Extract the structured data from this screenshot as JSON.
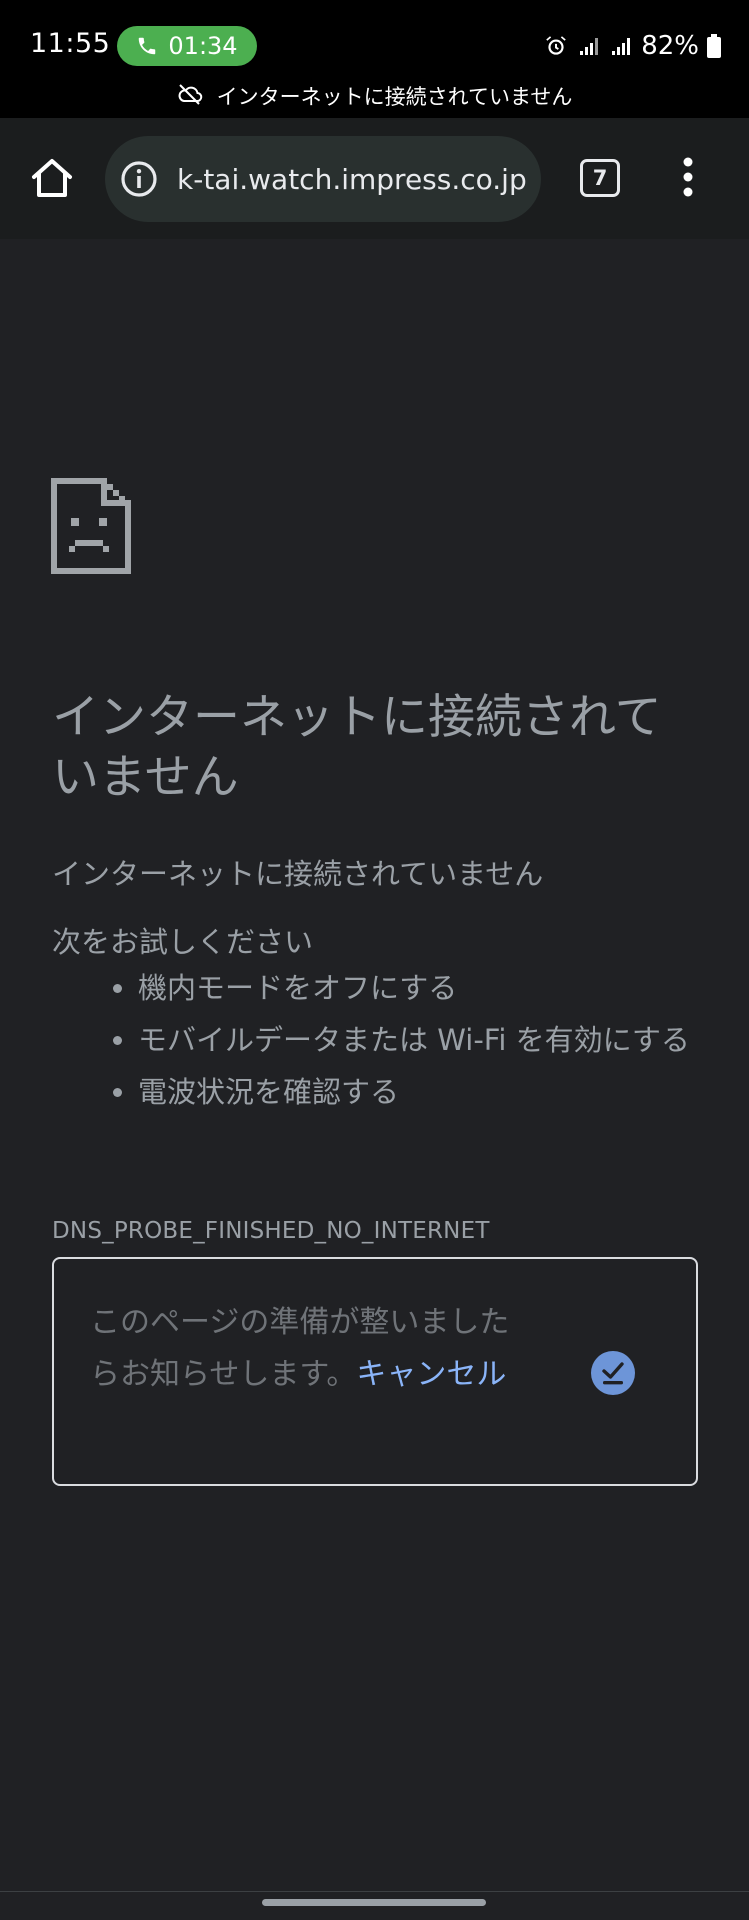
{
  "status_bar": {
    "time": "11:55",
    "call_duration": "01:34",
    "battery": "82%",
    "offline_notice": "インターネットに接続されていません"
  },
  "toolbar": {
    "url": "k-tai.watch.impress.co.jp",
    "tab_count": "7"
  },
  "error_page": {
    "heading": "インターネットに接続されていません",
    "subtext": "インターネットに接続されていません",
    "try_heading": "次をお試しください",
    "suggestions": [
      "機内モードをオフにする",
      "モバイルデータまたは Wi-Fi を有効にする",
      "電波状況を確認する"
    ],
    "error_code": "DNS_PROBE_FINISHED_NO_INTERNET",
    "notify": {
      "message": "このページの準備が整いましたらお知らせします。",
      "cancel_label": "キャンセル"
    }
  },
  "colors": {
    "page_background": "#202124",
    "text": "#9aa0a6",
    "link": "#8ab4f8",
    "call_chip": "#4caf50",
    "notify_icon": "#6d95d8"
  },
  "icons": {
    "home": "home-icon",
    "site_info": "info-icon",
    "menu": "more-vert-icon",
    "error": "sad-document-icon",
    "notify": "download-check-icon",
    "offline": "cloud-off-icon",
    "phone": "phone-icon",
    "alarm": "alarm-icon",
    "signal": "signal-icon",
    "battery": "battery-icon"
  }
}
